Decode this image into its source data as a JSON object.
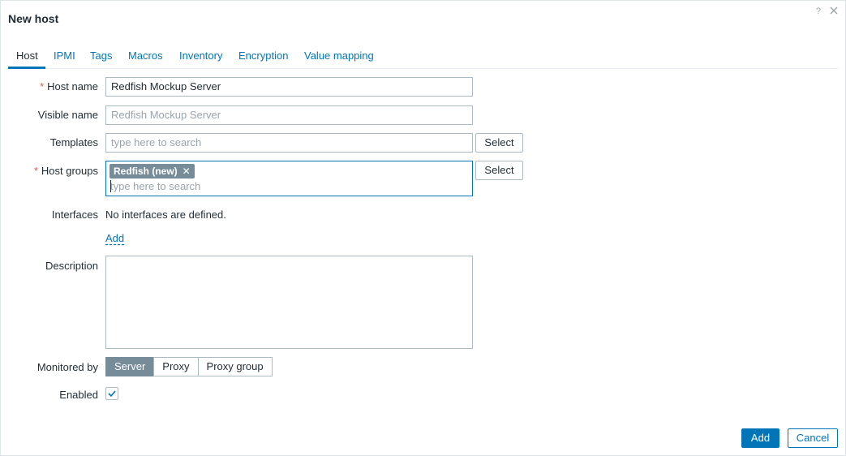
{
  "dialog": {
    "title": "New host",
    "help": "?"
  },
  "tabs": [
    {
      "label": "Host",
      "active": true
    },
    {
      "label": "IPMI"
    },
    {
      "label": "Tags"
    },
    {
      "label": "Macros"
    },
    {
      "label": "Inventory"
    },
    {
      "label": "Encryption"
    },
    {
      "label": "Value mapping"
    }
  ],
  "form": {
    "host_name": {
      "label": "Host name",
      "required": "*",
      "value": "Redfish Mockup Server"
    },
    "visible_name": {
      "label": "Visible name",
      "placeholder": "Redfish Mockup Server"
    },
    "templates": {
      "label": "Templates",
      "placeholder": "type here to search",
      "select_label": "Select"
    },
    "host_groups": {
      "label": "Host groups",
      "required": "*",
      "chip": "Redfish (new)",
      "chip_remove": "✕",
      "placeholder": "type here to search",
      "select_label": "Select"
    },
    "interfaces": {
      "label": "Interfaces",
      "text": "No interfaces are defined.",
      "add_link": "Add"
    },
    "description": {
      "label": "Description",
      "value": ""
    },
    "monitored_by": {
      "label": "Monitored by",
      "options": [
        "Server",
        "Proxy",
        "Proxy group"
      ],
      "selected": "Server"
    },
    "enabled": {
      "label": "Enabled",
      "checked": true
    }
  },
  "footer": {
    "add_label": "Add",
    "cancel_label": "Cancel"
  },
  "colors": {
    "accent": "#0275b8",
    "required": "#e45959",
    "toggle_active": "#768d99"
  }
}
